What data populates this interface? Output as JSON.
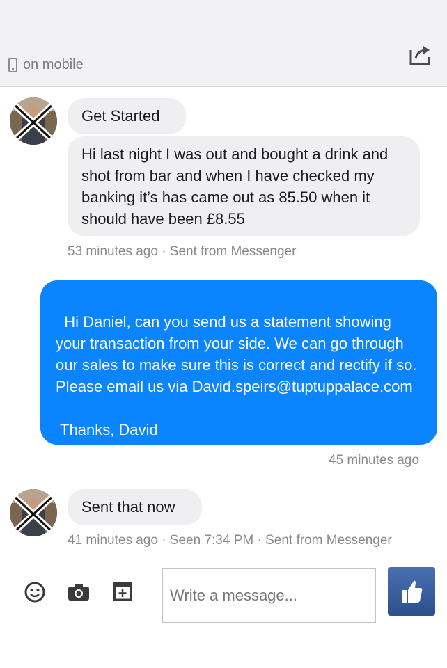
{
  "header": {
    "status_text": "on mobile",
    "status_icon": "mobile-phone-icon",
    "share_icon": "share-icon"
  },
  "messages": [
    {
      "id": "m1",
      "direction": "in",
      "text": "Get Started"
    },
    {
      "id": "m2",
      "direction": "in",
      "text": "Hi last night I was out and bought a drink and shot from bar and when I have checked my banking it’s has came out as 85.50 when it should have been £8.55"
    },
    {
      "id": "m3",
      "direction": "out",
      "text": "Hi Daniel, can you send us a statement showing your transaction from your side. We can go through our sales to make sure this is correct and rectify if so. Please email us via David.speirs@tuptuppalace.com\n\n Thanks, David"
    },
    {
      "id": "m4",
      "direction": "in",
      "text": "Sent that now"
    }
  ],
  "meta": {
    "m2": "53 minutes ago · Sent from Messenger",
    "m3": "45 minutes ago",
    "m4": "41 minutes ago · Seen 7:34 PM · Sent from Messenger"
  },
  "composer": {
    "placeholder": "Write a message...",
    "icons": [
      "smiley-icon",
      "camera-icon",
      "sticker-add-icon",
      "thumbs-up-icon"
    ]
  },
  "colors": {
    "outgoing_bubble": "#0a84ff",
    "incoming_bubble": "#efeff1",
    "like_button": "#3b5b9a"
  }
}
